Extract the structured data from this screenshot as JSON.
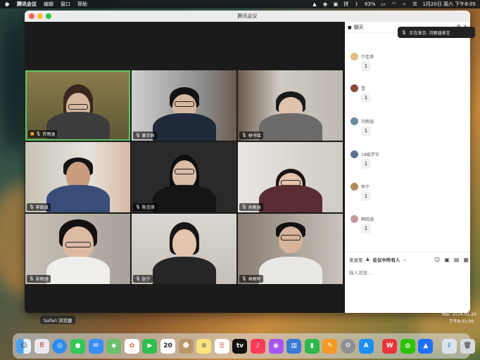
{
  "menubar": {
    "app_name": "腾讯会议",
    "menus": [
      "编辑",
      "窗口",
      "帮助"
    ],
    "battery": "93%",
    "datetime": "1月20日 周六 下午8:05"
  },
  "window": {
    "title": "腾讯会议"
  },
  "participants": [
    {
      "name": "齐雨涵",
      "active": true,
      "muted": false
    },
    {
      "name": "黄宇辰",
      "active": false,
      "muted": true
    },
    {
      "name": "林书瑶",
      "active": false,
      "muted": true
    },
    {
      "name": "李政城",
      "active": false,
      "muted": true
    },
    {
      "name": "陈佳琪",
      "active": false,
      "muted": true
    },
    {
      "name": "孙雨涵",
      "active": false,
      "muted": true
    },
    {
      "name": "张雨涵",
      "active": false,
      "muted": true
    },
    {
      "name": "赵宁",
      "active": false,
      "muted": true
    },
    {
      "name": "林雨轩",
      "active": false,
      "muted": true
    }
  ],
  "chat": {
    "title": "聊天",
    "notification": "正在发言: 刘雨涵发言",
    "messages": [
      {
        "sender": "宁佳琪",
        "text": "1"
      },
      {
        "sender": "雪",
        "text": "1"
      },
      {
        "sender": "刘雨涵",
        "text": "1"
      },
      {
        "sender": "18级学号",
        "text": "1"
      },
      {
        "sender": "李宁",
        "text": "1"
      },
      {
        "sender": "韩晓涵",
        "text": "1"
      }
    ],
    "send_to_label": "发送至",
    "send_to_value": "会议中所有人",
    "input_placeholder": "输入消息..."
  },
  "tooltip": {
    "text": "Safari 浏览器"
  },
  "side_texts": [
    "Mac 2024-01-20",
    "下午8:01:00"
  ],
  "dock": {
    "calendar_day": "20",
    "items": [
      "finder-icon",
      "launchpad-icon",
      "safari-icon",
      "messages-icon",
      "mail-icon",
      "maps-icon",
      "photos-icon",
      "facetime-icon",
      "calendar-icon",
      "contacts-icon",
      "notes-icon",
      "reminders-icon",
      "tv-icon",
      "music-icon",
      "podcasts-icon",
      "keynote-icon",
      "numbers-icon",
      "pages-icon",
      "system-settings-icon",
      "app-store-icon",
      "wps-icon",
      "wechat-icon",
      "tencent-meeting-icon",
      "downloads-icon",
      "trash-icon"
    ]
  }
}
